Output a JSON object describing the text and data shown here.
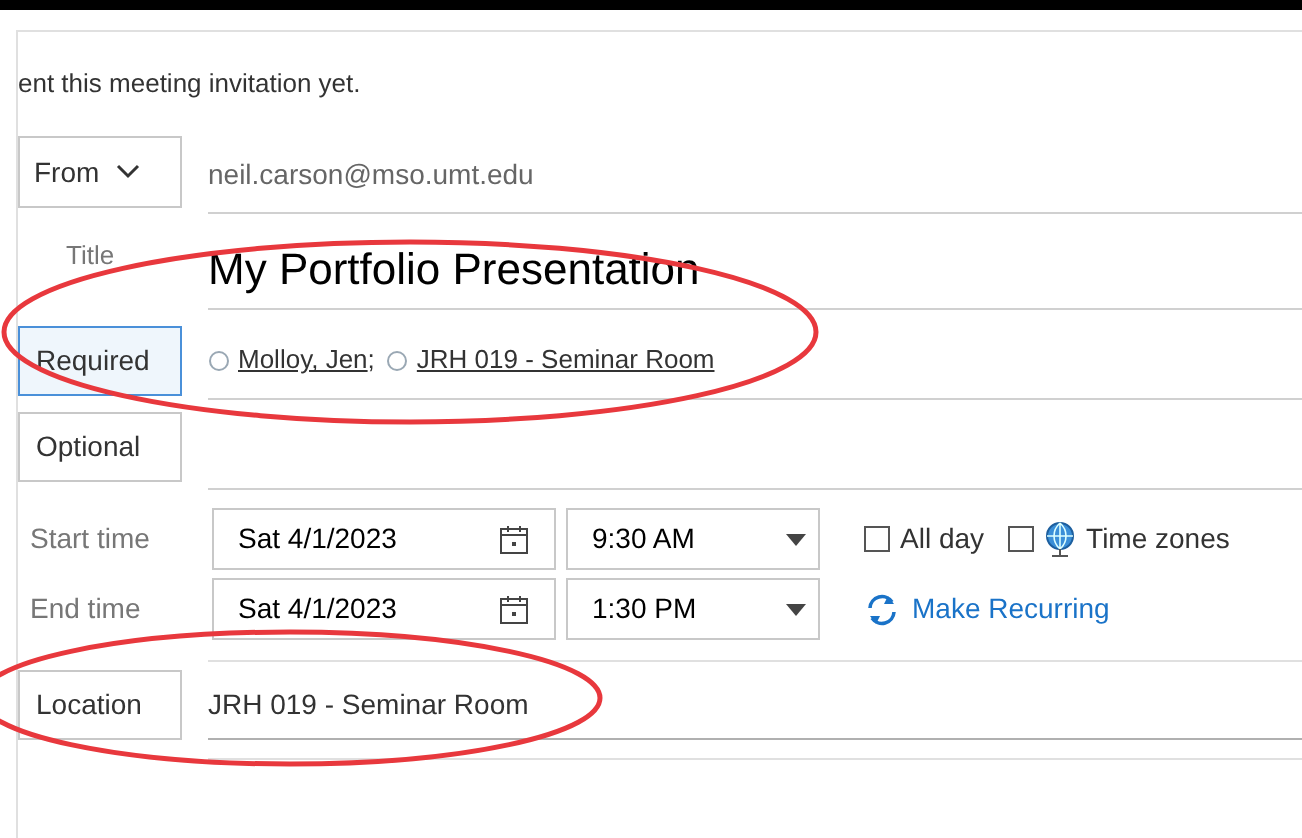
{
  "notice": "ent this meeting invitation yet.",
  "from": {
    "label": "From",
    "value": "neil.carson@mso.umt.edu"
  },
  "title": {
    "label": "Title",
    "value": "My Portfolio Presentation"
  },
  "required": {
    "label": "Required",
    "selected": true,
    "attendees": [
      {
        "name": "Molloy, Jen",
        "separator": ";"
      },
      {
        "name": "JRH 019 - Seminar Room"
      }
    ]
  },
  "optional": {
    "label": "Optional",
    "selected": false
  },
  "start": {
    "label": "Start time",
    "date": "Sat 4/1/2023",
    "time": "9:30 AM"
  },
  "end": {
    "label": "End time",
    "date": "Sat 4/1/2023",
    "time": "1:30 PM"
  },
  "options": [
    {
      "label": "All day",
      "checked": false,
      "kind": "plain"
    },
    {
      "label": "Time zones",
      "checked": false,
      "kind": "globe"
    }
  ],
  "recurring": "Make Recurring",
  "location": {
    "label": "Location",
    "value": "JRH 019 - Seminar Room"
  }
}
